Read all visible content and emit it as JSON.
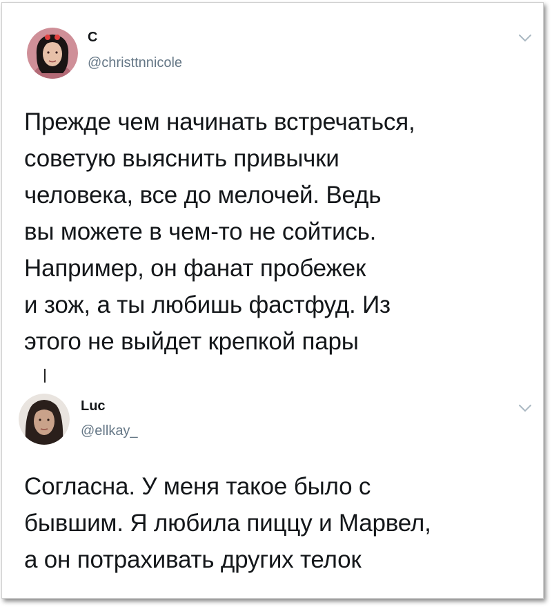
{
  "tweets": [
    {
      "name": "С",
      "handle": "@christtnnicole",
      "text_lines": [
        "Прежде чем начинать встречаться,",
        "советую выяснить привычки",
        "человека, все до мелочей. Ведь",
        "вы можете в чем-то не сойтись.",
        "Например, он фанат пробежек",
        "и зож, а ты любишь фастфуд. Из",
        "этого не выйдет крепкой пары"
      ],
      "avatar_icon": "user-avatar-icon",
      "menu_icon": "chevron-down-icon"
    },
    {
      "name": "Luc",
      "handle": "@ellkay_",
      "text_lines": [
        "Согласна. У меня такое было с",
        "бывшим. Я любила пиццу и Марвел,",
        "а он потрахивать других телок"
      ],
      "avatar_icon": "user-avatar-icon",
      "menu_icon": "chevron-down-icon"
    }
  ],
  "colors": {
    "text": "#14171a",
    "secondary": "#657786",
    "chevron": "#aab8c2"
  }
}
